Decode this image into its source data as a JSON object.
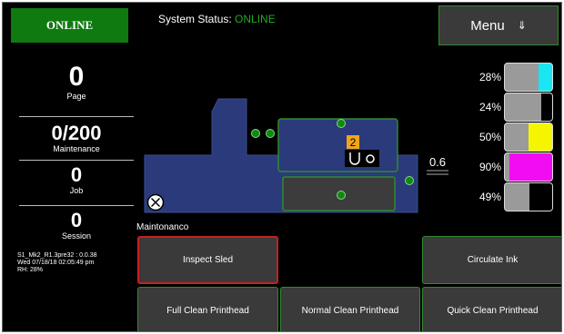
{
  "header": {
    "online_label": "ONLINE",
    "status_label": "System Status:",
    "status_value": "ONLINE",
    "menu_label": "Menu",
    "menu_icon": "double-arrow-down-icon"
  },
  "counters": [
    {
      "value": "0",
      "label": "Page"
    },
    {
      "value": "0/200",
      "label": "Maintenance"
    },
    {
      "value": "0",
      "label": "Job"
    },
    {
      "value": "0",
      "label": "Session"
    }
  ],
  "info": {
    "version": "S1_Mk2_R1.3pre32 : 0.0.38",
    "datetime": "Wed 07/18/18 02:05:49 pm",
    "rh": "RH: 28%"
  },
  "diagram": {
    "sled_position": "2",
    "gap_value": "0.6"
  },
  "inks": [
    {
      "percent": "28%",
      "level": 0.28,
      "color": "#19e6f2"
    },
    {
      "percent": "24%",
      "level": 0.24,
      "color": "#000000"
    },
    {
      "percent": "50%",
      "level": 0.5,
      "color": "#f5f500"
    },
    {
      "percent": "90%",
      "level": 0.9,
      "color": "#f20cf2"
    },
    {
      "percent": "49%",
      "level": 0.49,
      "color": "#000000"
    }
  ],
  "maintenance": {
    "label": "Maintonanco",
    "buttons": {
      "inspect_sled": "Inspect Sled",
      "circulate_ink": "Circulate Ink",
      "full_clean": "Full Clean Printhead",
      "normal_clean": "Normal Clean Printhead",
      "quick_clean": "Quick Clean Printhead"
    }
  },
  "colors": {
    "online_green": "#0f7a10",
    "status_green": "#1faa1f",
    "button_border": "#2f8a2f",
    "selected_border": "#c62020",
    "sled_blue": "#2a3a7a"
  }
}
